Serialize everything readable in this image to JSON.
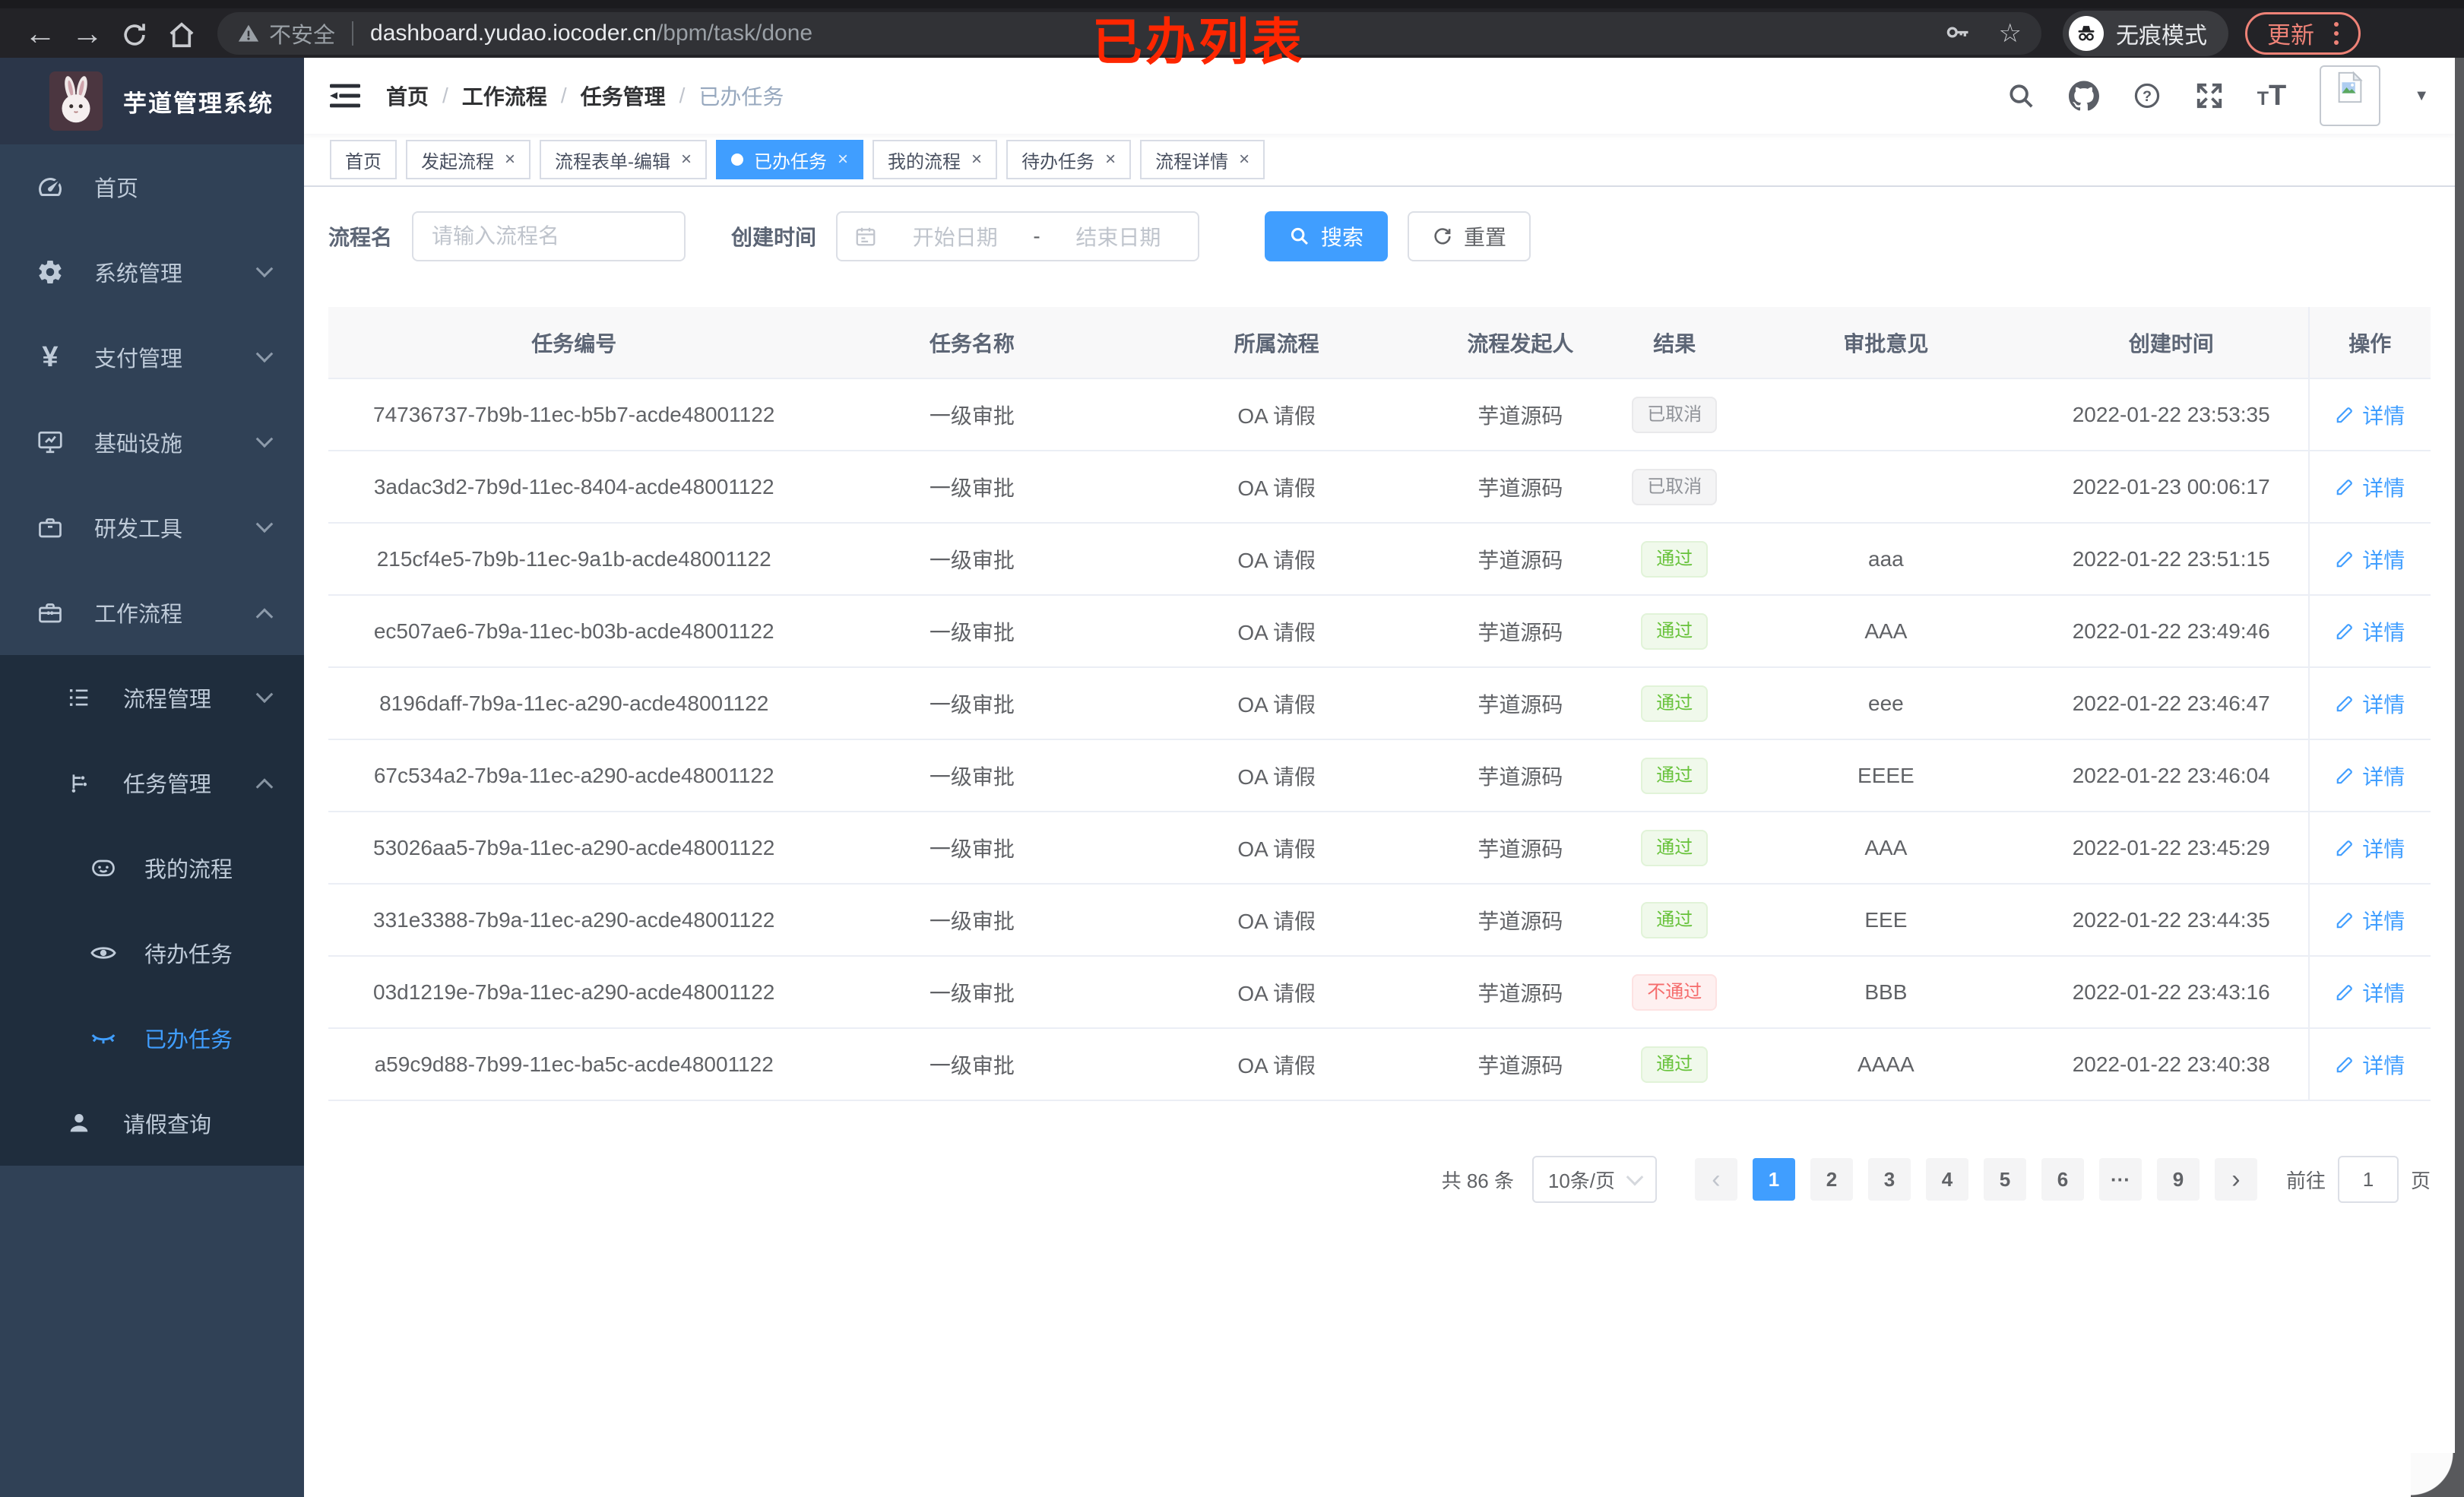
{
  "browser": {
    "security_label": "不安全",
    "url_host": "dashboard.yudao.iocoder.cn",
    "url_path": "/bpm/task/done",
    "incognito_label": "无痕模式",
    "update_label": "更新"
  },
  "overlay_title": "已办列表",
  "glyphs": {
    "back": "←",
    "forward": "→",
    "star": "☆",
    "close": "×",
    "caret_down": "▼"
  },
  "sidebar": {
    "app_title": "芋道管理系统",
    "items": [
      {
        "label": "首页"
      },
      {
        "label": "系统管理"
      },
      {
        "label": "支付管理"
      },
      {
        "label": "基础设施"
      },
      {
        "label": "研发工具"
      },
      {
        "label": "工作流程"
      },
      {
        "label": "流程管理"
      },
      {
        "label": "任务管理"
      },
      {
        "label": "我的流程"
      },
      {
        "label": "待办任务"
      },
      {
        "label": "已办任务"
      },
      {
        "label": "请假查询"
      }
    ]
  },
  "breadcrumb": {
    "separator": "/",
    "items": [
      "首页",
      "工作流程",
      "任务管理",
      "已办任务"
    ]
  },
  "tabs": [
    {
      "label": "首页"
    },
    {
      "label": "发起流程"
    },
    {
      "label": "流程表单-编辑"
    },
    {
      "label": "已办任务"
    },
    {
      "label": "我的流程"
    },
    {
      "label": "待办任务"
    },
    {
      "label": "流程详情"
    }
  ],
  "filters": {
    "name_label": "流程名",
    "name_placeholder": "请输入流程名",
    "time_label": "创建时间",
    "start_placeholder": "开始日期",
    "range_separator": "-",
    "end_placeholder": "结束日期",
    "search_label": "搜索",
    "reset_label": "重置"
  },
  "table": {
    "headers": [
      "任务编号",
      "任务名称",
      "所属流程",
      "流程发起人",
      "结果",
      "审批意见",
      "创建时间",
      "操作"
    ],
    "rows": [
      {
        "id": "74736737-7b9b-11ec-b5b7-acde48001122",
        "name": "一级审批",
        "process": "OA 请假",
        "starter": "芋道源码",
        "result": {
          "label": "已取消",
          "type": "info"
        },
        "opinion": "",
        "created": "2022-01-22 23:53:35",
        "action": "详情"
      },
      {
        "id": "3adac3d2-7b9d-11ec-8404-acde48001122",
        "name": "一级审批",
        "process": "OA 请假",
        "starter": "芋道源码",
        "result": {
          "label": "已取消",
          "type": "info"
        },
        "opinion": "",
        "created": "2022-01-23 00:06:17",
        "action": "详情"
      },
      {
        "id": "215cf4e5-7b9b-11ec-9a1b-acde48001122",
        "name": "一级审批",
        "process": "OA 请假",
        "starter": "芋道源码",
        "result": {
          "label": "通过",
          "type": "success"
        },
        "opinion": "aaa",
        "created": "2022-01-22 23:51:15",
        "action": "详情"
      },
      {
        "id": "ec507ae6-7b9a-11ec-b03b-acde48001122",
        "name": "一级审批",
        "process": "OA 请假",
        "starter": "芋道源码",
        "result": {
          "label": "通过",
          "type": "success"
        },
        "opinion": "AAA",
        "created": "2022-01-22 23:49:46",
        "action": "详情"
      },
      {
        "id": "8196daff-7b9a-11ec-a290-acde48001122",
        "name": "一级审批",
        "process": "OA 请假",
        "starter": "芋道源码",
        "result": {
          "label": "通过",
          "type": "success"
        },
        "opinion": "eee",
        "created": "2022-01-22 23:46:47",
        "action": "详情"
      },
      {
        "id": "67c534a2-7b9a-11ec-a290-acde48001122",
        "name": "一级审批",
        "process": "OA 请假",
        "starter": "芋道源码",
        "result": {
          "label": "通过",
          "type": "success"
        },
        "opinion": "EEEE",
        "created": "2022-01-22 23:46:04",
        "action": "详情"
      },
      {
        "id": "53026aa5-7b9a-11ec-a290-acde48001122",
        "name": "一级审批",
        "process": "OA 请假",
        "starter": "芋道源码",
        "result": {
          "label": "通过",
          "type": "success"
        },
        "opinion": "AAA",
        "created": "2022-01-22 23:45:29",
        "action": "详情"
      },
      {
        "id": "331e3388-7b9a-11ec-a290-acde48001122",
        "name": "一级审批",
        "process": "OA 请假",
        "starter": "芋道源码",
        "result": {
          "label": "通过",
          "type": "success"
        },
        "opinion": "EEE",
        "created": "2022-01-22 23:44:35",
        "action": "详情"
      },
      {
        "id": "03d1219e-7b9a-11ec-a290-acde48001122",
        "name": "一级审批",
        "process": "OA 请假",
        "starter": "芋道源码",
        "result": {
          "label": "不通过",
          "type": "danger"
        },
        "opinion": "BBB",
        "created": "2022-01-22 23:43:16",
        "action": "详情"
      },
      {
        "id": "a59c9d88-7b99-11ec-ba5c-acde48001122",
        "name": "一级审批",
        "process": "OA 请假",
        "starter": "芋道源码",
        "result": {
          "label": "通过",
          "type": "success"
        },
        "opinion": "AAAA",
        "created": "2022-01-22 23:40:38",
        "action": "详情"
      }
    ]
  },
  "pagination": {
    "total": "共 86 条",
    "page_size": "10条/页",
    "prev": "‹",
    "next": "›",
    "pages": [
      "1",
      "2",
      "3",
      "4",
      "5",
      "6",
      "9"
    ],
    "ellipsis": "···",
    "goto_label": "前往",
    "goto_value": "1",
    "page_unit": "页"
  },
  "colors": {
    "accent": "#409eff",
    "sidebar_bg": "#304156",
    "submenu_bg": "#1f2d3d",
    "success": "#67c23a",
    "danger": "#f56c6c",
    "info": "#909399"
  }
}
